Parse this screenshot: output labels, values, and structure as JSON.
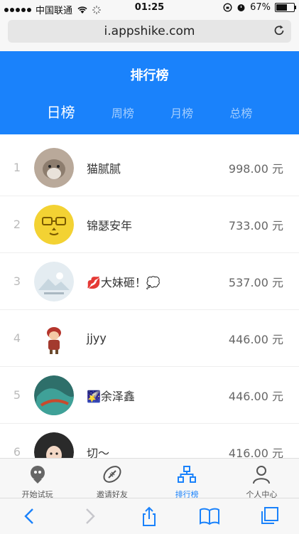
{
  "status": {
    "carrier": "中国联通",
    "time": "01:25",
    "battery": "67%",
    "battery_level": 0.67
  },
  "browser": {
    "url": "i.appshike.com"
  },
  "header": {
    "title": "排行榜",
    "tabs": [
      {
        "label": "日榜"
      },
      {
        "label": "周榜"
      },
      {
        "label": "月榜"
      },
      {
        "label": "总榜"
      }
    ]
  },
  "ranking": [
    {
      "rank": "1",
      "name": "猫腻腻",
      "amount": "998.00 元"
    },
    {
      "rank": "2",
      "name": "锦瑟安年",
      "amount": "733.00 元"
    },
    {
      "rank": "3",
      "name": "💋大妹砸！💭",
      "amount": "537.00 元"
    },
    {
      "rank": "4",
      "name": "jjyy",
      "amount": "446.00 元"
    },
    {
      "rank": "5",
      "name": "🌠余泽鑫",
      "amount": "446.00 元"
    },
    {
      "rank": "6",
      "name": "切～",
      "amount": "416.00 元"
    }
  ],
  "nav": [
    {
      "label": "开始试玩",
      "icon": "start-trial-icon"
    },
    {
      "label": "邀请好友",
      "icon": "football-icon"
    },
    {
      "label": "排行榜",
      "icon": "ranking-icon"
    },
    {
      "label": "个人中心",
      "icon": "user-icon"
    }
  ],
  "colors": {
    "accent": "#1a82fb"
  }
}
